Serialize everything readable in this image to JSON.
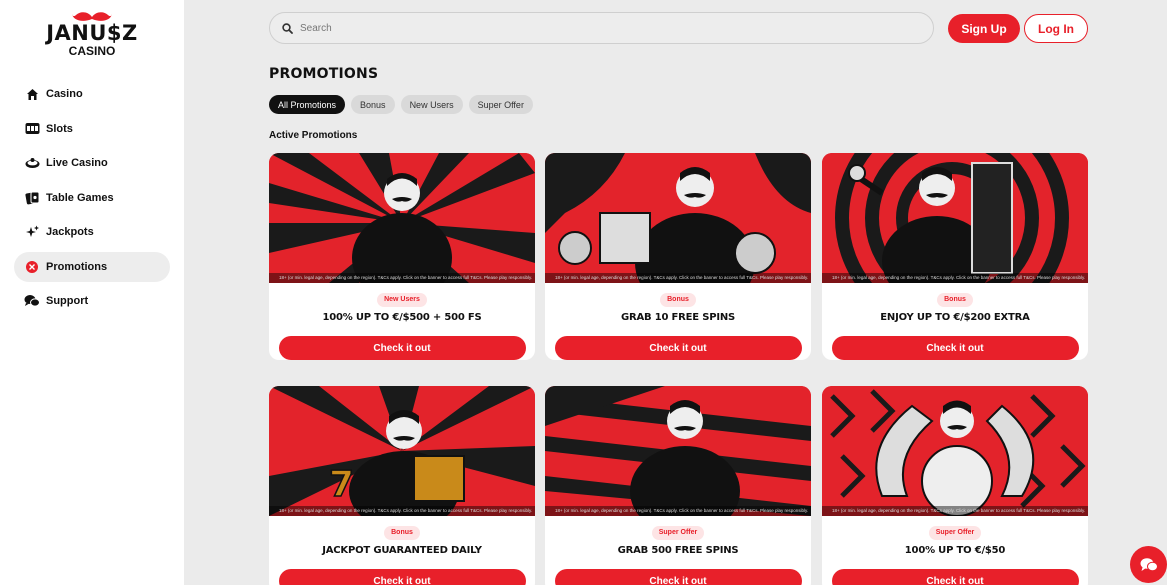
{
  "brand": {
    "logo_line1": "JANU$Z",
    "logo_line2": "CASINO",
    "accent": "#e8202a"
  },
  "sidebar": {
    "items": [
      {
        "label": "Casino",
        "icon": "home-icon",
        "active": false
      },
      {
        "label": "Slots",
        "icon": "slot-machine-icon",
        "active": false
      },
      {
        "label": "Live Casino",
        "icon": "live-casino-icon",
        "active": false
      },
      {
        "label": "Table Games",
        "icon": "cards-icon",
        "active": false
      },
      {
        "label": "Jackpots",
        "icon": "sparkle-icon",
        "active": false
      },
      {
        "label": "Promotions",
        "icon": "promotions-icon",
        "active": true
      },
      {
        "label": "Support",
        "icon": "chat-bubbles-icon",
        "active": false
      }
    ]
  },
  "header": {
    "search_placeholder": "Search",
    "signup_label": "Sign Up",
    "login_label": "Log In"
  },
  "main": {
    "title": "PROMOTIONS",
    "filters": [
      {
        "label": "All Promotions",
        "active": true
      },
      {
        "label": "Bonus",
        "active": false
      },
      {
        "label": "New Users",
        "active": false
      },
      {
        "label": "Super Offer",
        "active": false
      }
    ],
    "section_title": "Active Promotions",
    "cards": [
      {
        "badge": "New Users",
        "title": "100% UP TO €/$500 + 500 FS",
        "cta": "Check it out",
        "disclaimer": "18+ (or min. legal age, depending on the region). T&Cs apply. Click on the banner to access full T&Cs. Please play responsibly."
      },
      {
        "badge": "Bonus",
        "title": "GRAB 10 FREE SPINS",
        "cta": "Check it out",
        "disclaimer": "18+ (or min. legal age, depending on the region). T&Cs apply. Click on the banner to access full T&Cs. Please play responsibly."
      },
      {
        "badge": "Bonus",
        "title": "ENJOY UP TO €/$200 EXTRA",
        "cta": "Check it out",
        "disclaimer": "18+ (or min. legal age, depending on the region). T&Cs apply. Click on the banner to access full T&Cs. Please play responsibly."
      },
      {
        "badge": "Bonus",
        "title": "JACKPOT GUARANTEED DAILY",
        "cta": "Check it out",
        "disclaimer": "18+ (or min. legal age, depending on the region). T&Cs apply. Click on the banner to access full T&Cs. Please play responsibly."
      },
      {
        "badge": "Super Offer",
        "title": "GRAB 500 FREE SPINS",
        "cta": "Check it out",
        "disclaimer": "18+ (or min. legal age, depending on the region). T&Cs apply. Click on the banner to access full T&Cs. Please play responsibly."
      },
      {
        "badge": "Super Offer",
        "title": "100% UP TO €/$50",
        "cta": "Check it out",
        "disclaimer": "18+ (or min. legal age, depending on the region). T&Cs apply. Click on the banner to access full T&Cs. Please play responsibly."
      }
    ]
  },
  "chat": {
    "icon": "chat-icon"
  }
}
